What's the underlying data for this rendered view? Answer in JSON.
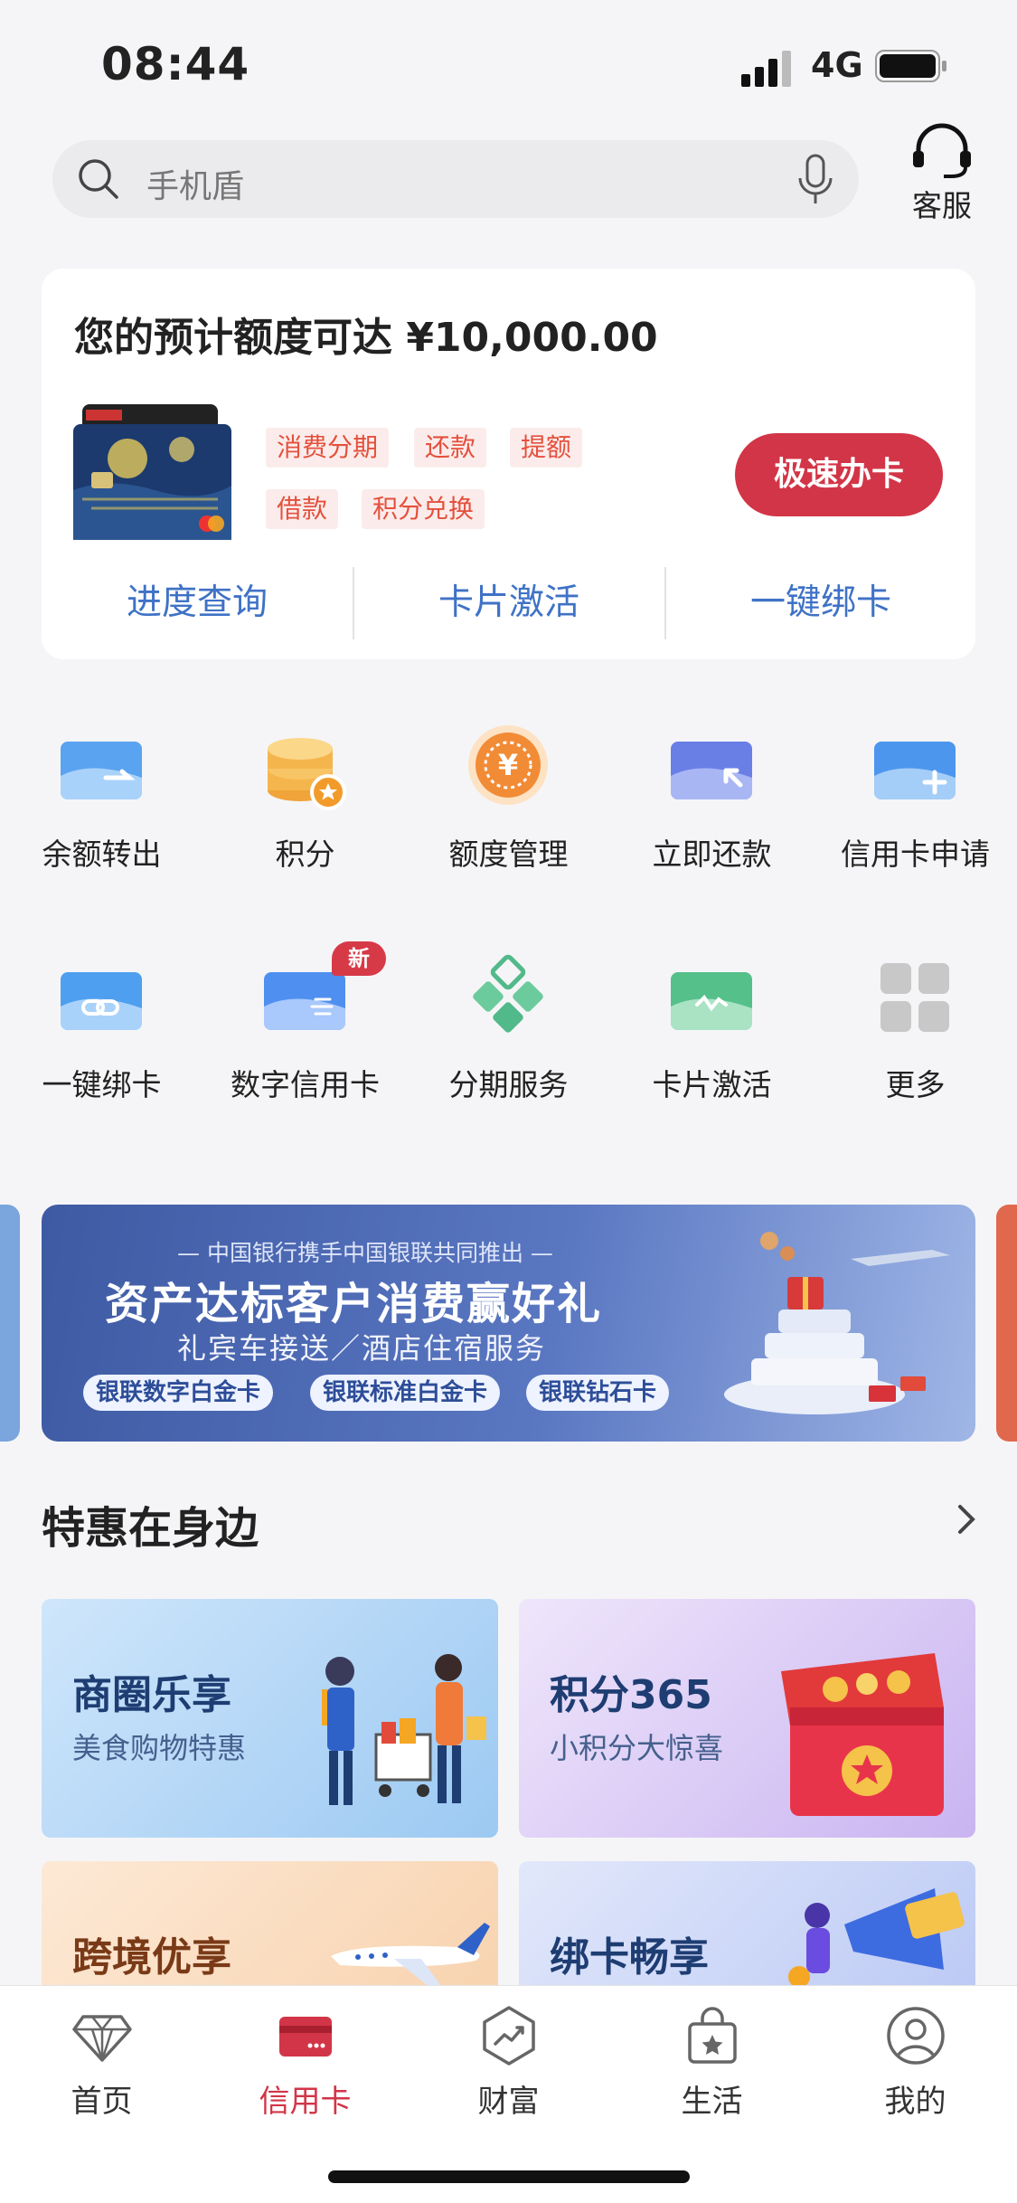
{
  "status_bar": {
    "time": "08:44",
    "network": "4G"
  },
  "search": {
    "placeholder": "手机盾"
  },
  "service": {
    "label": "客服"
  },
  "credit_card": {
    "title": "您的预计额度可达 ¥10,000.00",
    "tags": [
      "消费分期",
      "还款",
      "提额",
      "借款",
      "积分兑换"
    ],
    "apply_button": "极速办卡",
    "links": [
      "进度查询",
      "卡片激活",
      "一键绑卡"
    ]
  },
  "grid": [
    {
      "label": "余额转出",
      "icon": "card-transfer-icon"
    },
    {
      "label": "积分",
      "icon": "points-coins-icon"
    },
    {
      "label": "额度管理",
      "icon": "yuan-coin-icon"
    },
    {
      "label": "立即还款",
      "icon": "card-repay-icon"
    },
    {
      "label": "信用卡申请",
      "icon": "card-apply-icon"
    },
    {
      "label": "一键绑卡",
      "icon": "card-bind-icon"
    },
    {
      "label": "数字信用卡",
      "icon": "digital-card-icon",
      "badge": "新"
    },
    {
      "label": "分期服务",
      "icon": "installment-diamond-icon"
    },
    {
      "label": "卡片激活",
      "icon": "card-activate-icon"
    },
    {
      "label": "更多",
      "icon": "more-grid-icon"
    }
  ],
  "banner": {
    "subtitle": "— 中国银行携手中国银联共同推出 —",
    "title": "资产达标客户消费赢好礼",
    "subtitle2": "礼宾车接送／酒店住宿服务",
    "pills": [
      "银联数字白金卡",
      "银联标准白金卡",
      "银联钻石卡"
    ]
  },
  "section": {
    "title": "特惠在身边"
  },
  "promos": [
    {
      "title": "商圈乐享",
      "subtitle": "美食购物特惠"
    },
    {
      "title": "积分365",
      "subtitle": "小积分大惊喜"
    },
    {
      "title": "跨境优享",
      "subtitle": ""
    },
    {
      "title": "绑卡畅享",
      "subtitle": ""
    }
  ],
  "tabbar": [
    {
      "label": "首页",
      "icon": "diamond-icon"
    },
    {
      "label": "信用卡",
      "icon": "credit-card-icon",
      "active": true
    },
    {
      "label": "财富",
      "icon": "wealth-chart-icon"
    },
    {
      "label": "生活",
      "icon": "shopping-bag-icon"
    },
    {
      "label": "我的",
      "icon": "profile-icon"
    }
  ],
  "colors": {
    "brand_red": "#d23547",
    "link_blue": "#3f72c6",
    "tag_red": "#e4503c"
  }
}
